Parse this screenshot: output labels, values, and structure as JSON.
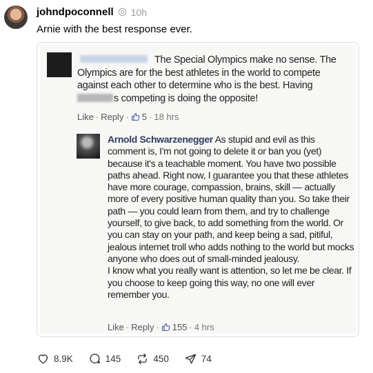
{
  "post": {
    "username": "johndpoconnell",
    "time": "10h",
    "text": "Arnie with the best response ever."
  },
  "image": {
    "comment1": {
      "text_line1": "The Special Olympics make no sense. The Olympics are for the best athletes in the world to compete against each other to determine who is the best. Having",
      "text_line2": "s competing is doing the opposite!",
      "like": "Like",
      "dot": "·",
      "reply": "Reply",
      "likes": "5",
      "time": "18 hrs"
    },
    "comment2": {
      "author": "Arnold Schwarzenegger",
      "text": "As stupid and evil as this comment is, I'm not going to delete it or ban you (yet) because it's a teachable moment. You have two possible paths ahead. Right now, I guarantee you that these athletes have more courage, compassion, brains, skill — actually more of every positive human quality than you. So take their path — you could learn from them, and try to challenge yourself, to give back, to add something from the world. Or you can stay on your path, and keep being a sad, pitiful, jealous internet troll who adds nothing to the world but mocks anyone who does out of small-minded jealousy.",
      "text2": "I know what you really want is attention, so let me be clear. If you choose to keep going this way, no one will ever remember you.",
      "like": "Like",
      "dot": "·",
      "reply": "Reply",
      "likes": "155",
      "time": "4 hrs"
    }
  },
  "actions": {
    "likes": "8.9K",
    "comments": "145",
    "reposts": "450",
    "shares": "74"
  }
}
